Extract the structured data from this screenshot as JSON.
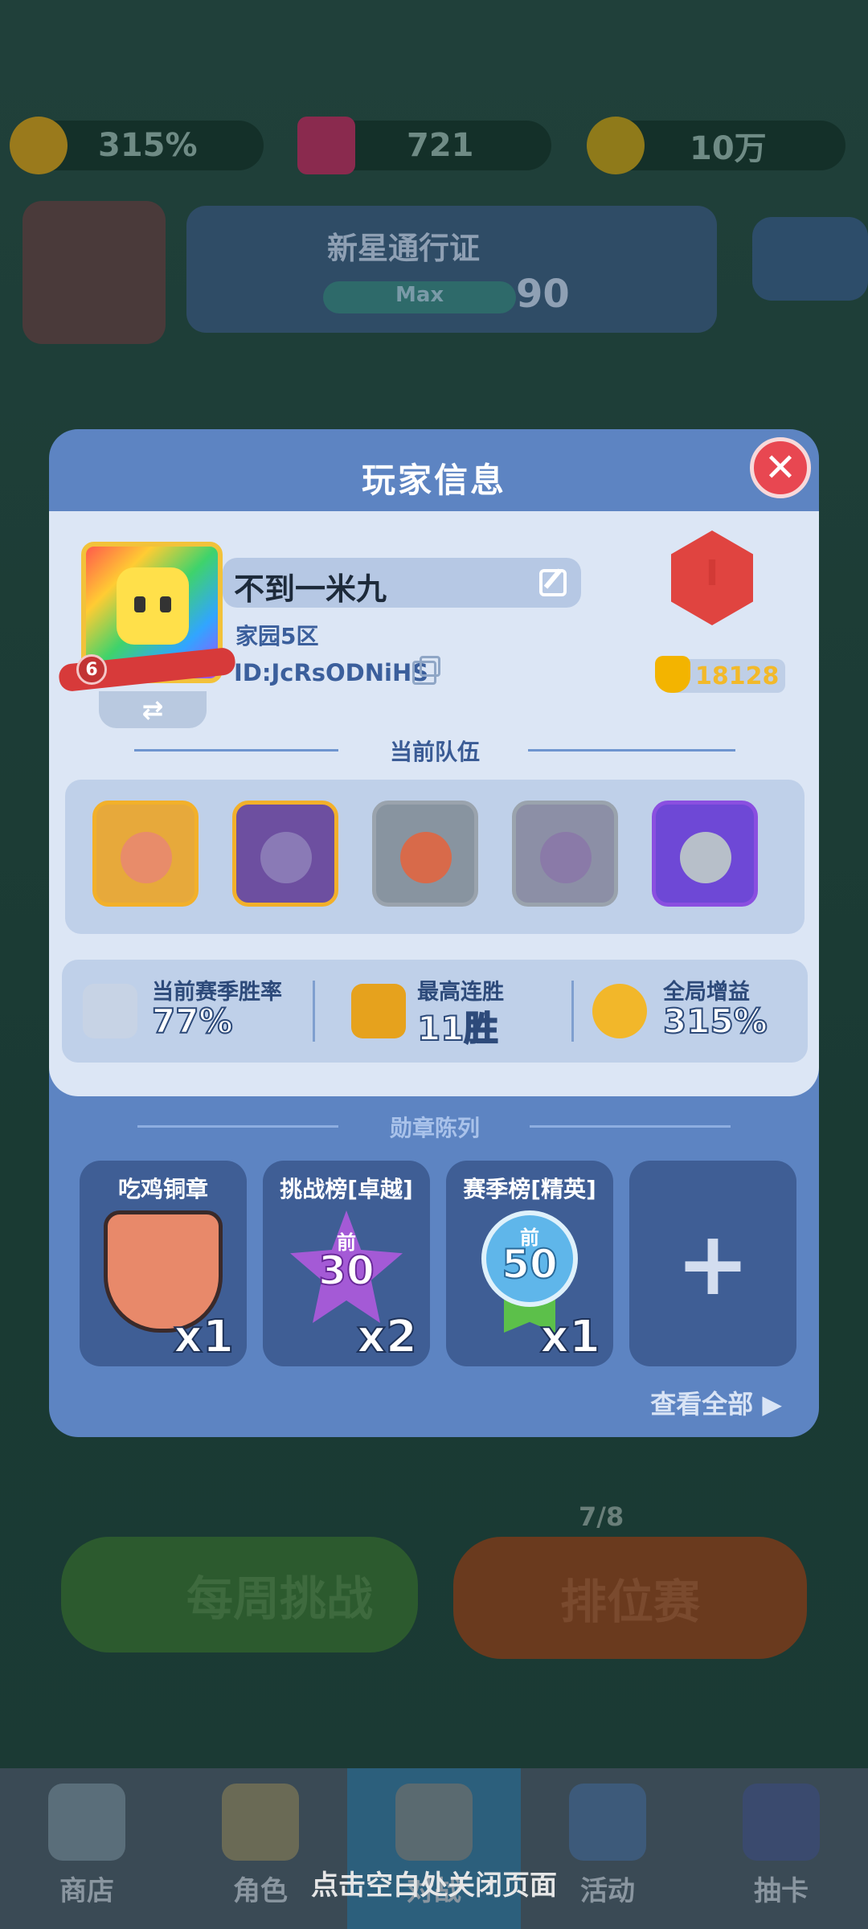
{
  "background": {
    "resources": [
      {
        "name": "boost",
        "value": "315%"
      },
      {
        "name": "gems",
        "value": "721"
      },
      {
        "name": "coins",
        "value": "10万"
      }
    ],
    "pass": {
      "title": "新星通行证",
      "progress_label": "Max",
      "level": "90"
    },
    "profile_level": "6",
    "weekly_challenge": "每周挑战",
    "ranked": "排位赛",
    "ranked_progress": "7/8",
    "tabs": [
      {
        "label": "商店"
      },
      {
        "label": "角色"
      },
      {
        "label": "对战"
      },
      {
        "label": "活动"
      },
      {
        "label": "抽卡"
      }
    ],
    "close_hint": "点击空白处关闭页面"
  },
  "modal": {
    "title": "玩家信息",
    "player": {
      "name": "不到一米九",
      "server": "家园5区",
      "id": "ID:JcRsODNiHS",
      "level": "6",
      "rank_letter": "I",
      "trophies": "18128"
    },
    "team_title": "当前队伍",
    "heroes": [
      {
        "icon": "king-hero-icon",
        "frame": "#f2b02a"
      },
      {
        "icon": "dark-knight-hero-icon",
        "frame": "#f2b02a"
      },
      {
        "icon": "warrior-hero-icon",
        "frame": "#9aa3ad"
      },
      {
        "icon": "ghost-hero-icon",
        "frame": "#9aa3ad"
      },
      {
        "icon": "armored-knight-hero-icon",
        "frame": "#8a4fe0"
      }
    ],
    "stats": [
      {
        "label": "当前赛季胜率",
        "value": "77%"
      },
      {
        "label": "最高连胜",
        "value": "11胜"
      },
      {
        "label": "全局增益",
        "value": "315%"
      }
    ],
    "medals_title": "勋章陈列",
    "medals": [
      {
        "label": "吃鸡铜章",
        "count": "x1",
        "badge_text": ""
      },
      {
        "label": "挑战榜[卓越]",
        "count": "x2",
        "badge_top": "前",
        "badge_text": "30"
      },
      {
        "label": "赛季榜[精英]",
        "count": "x1",
        "badge_top": "前",
        "badge_text": "50"
      }
    ],
    "add_medal": "+",
    "view_all": "查看全部 ▶"
  },
  "colors": {
    "modal_bg": "#5d84c2",
    "inner_bg": "#dce6f5",
    "close_red": "#e84751",
    "trophy_gold": "#f2b92a"
  }
}
